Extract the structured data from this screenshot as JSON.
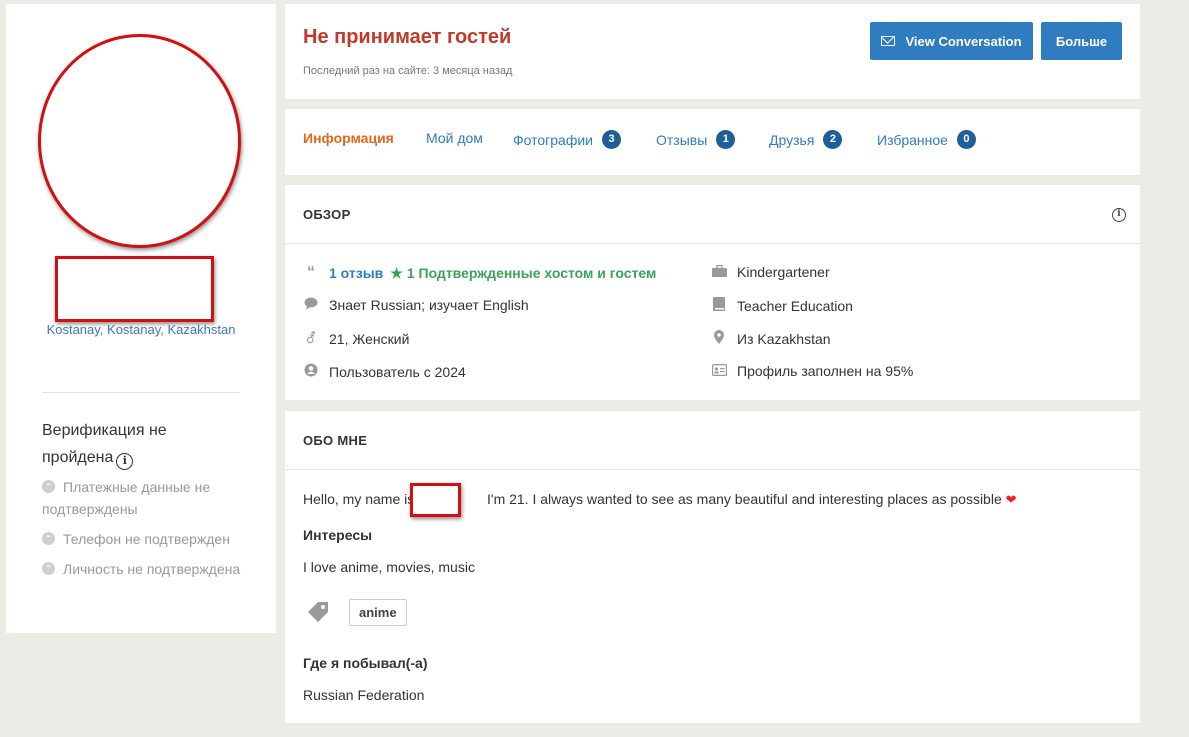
{
  "profile": {
    "location": "Kostanay, Kostanay, Kazakhstan",
    "verification": {
      "title": "Верификация не пройдена",
      "items": [
        "Платежные данные не подтверждены",
        "Телефон не подтвержден",
        "Личность не подтверждена"
      ]
    }
  },
  "header": {
    "hosting_status": "Не принимает гостей",
    "last_seen": "Последний раз на сайте: 3 месяца назад",
    "view_conversation_label": "View Conversation",
    "more_label": "Больше"
  },
  "tabs": [
    {
      "label": "Информация",
      "badge": ""
    },
    {
      "label": "Мой дом",
      "badge": ""
    },
    {
      "label": "Фотографии",
      "badge": "3"
    },
    {
      "label": "Отзывы",
      "badge": "1"
    },
    {
      "label": "Друзья",
      "badge": "2"
    },
    {
      "label": "Избранное",
      "badge": "0"
    }
  ],
  "overview": {
    "title": "ОБЗОР",
    "reviews": "1 отзыв",
    "confirmed": "1 Подтвержденные хостом и гостем",
    "languages": "Знает Russian; изучает English",
    "age_gender": "21, Женский",
    "member_since": "Пользователь с 2024",
    "occupation": "Kindergartener",
    "education": "Teacher Education",
    "hometown": "Из Kazakhstan",
    "profile_complete": "Профиль заполнен на 95%"
  },
  "about": {
    "title": "ОБО МНЕ",
    "bio_start": "Hello, my name is",
    "bio_end": "I'm 21. I always wanted to see as many beautiful and interesting places as possible",
    "interests_title": "Интересы",
    "interests_text": "I love anime, movies, music",
    "tag": "anime",
    "visited_title": "Где я побывал(-а)",
    "visited_text": "Russian Federation"
  },
  "colors": {
    "accent_blue": "#2f7cc0",
    "active_tab": "#e0681c",
    "status_red": "#c0392b",
    "confirmed_green": "#3aa35a",
    "redaction": "#d30f0f"
  }
}
